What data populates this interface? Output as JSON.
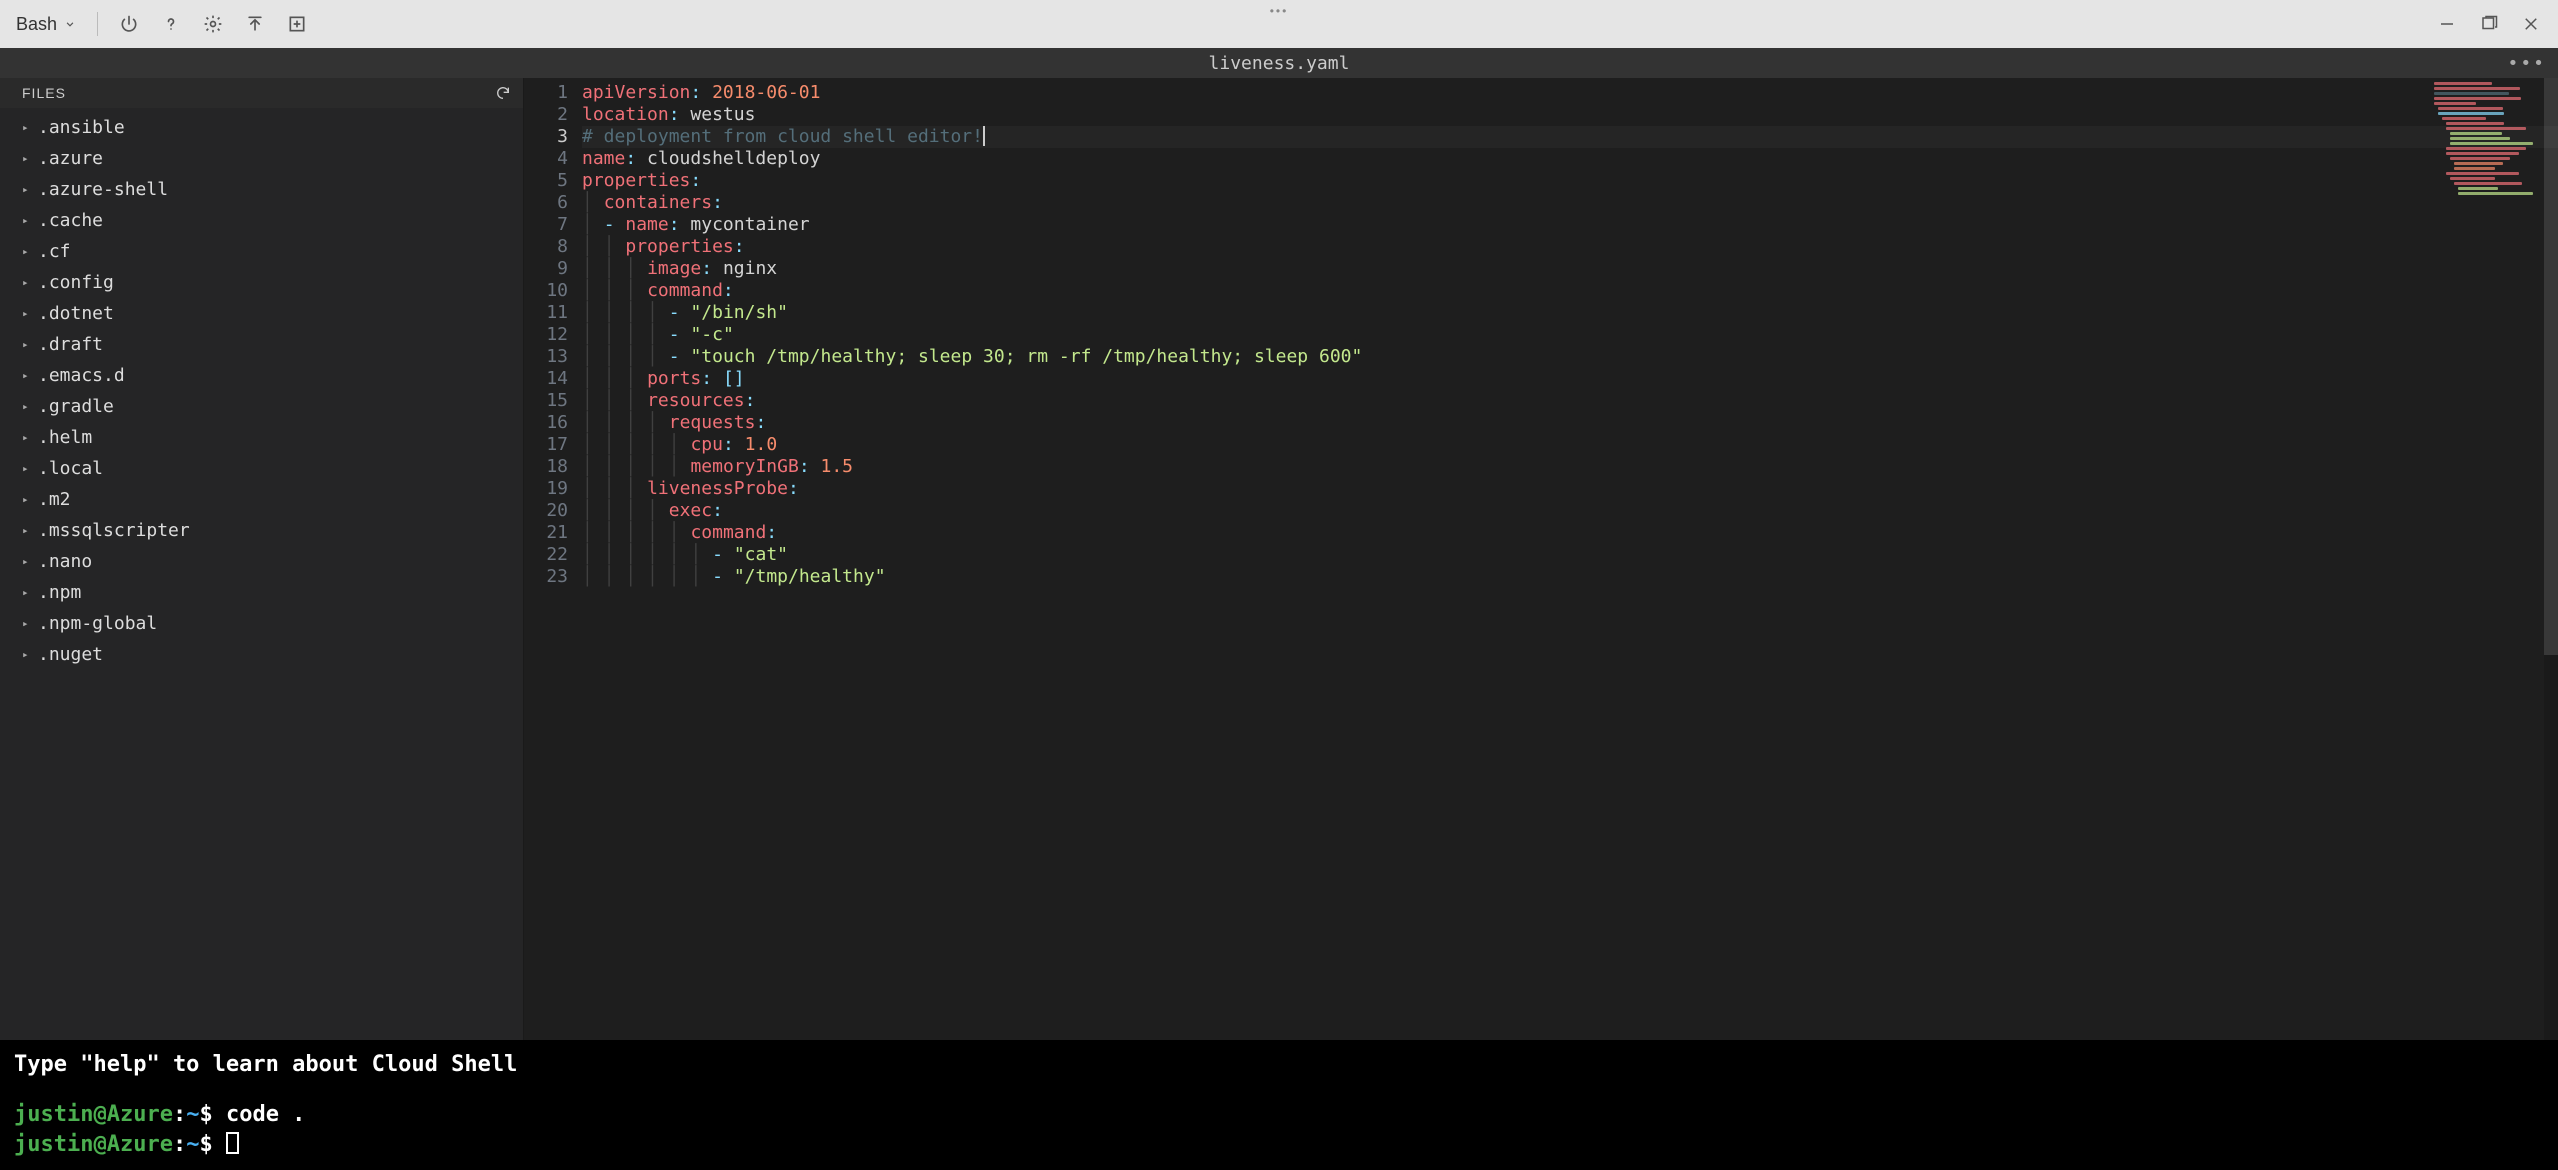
{
  "toolbar": {
    "shell_label": "Bash"
  },
  "editor": {
    "filename": "liveness.yaml",
    "sidebar_header": "FILES",
    "current_line": 3,
    "files": [
      ".ansible",
      ".azure",
      ".azure-shell",
      ".cache",
      ".cf",
      ".config",
      ".dotnet",
      ".draft",
      ".emacs.d",
      ".gradle",
      ".helm",
      ".local",
      ".m2",
      ".mssqlscripter",
      ".nano",
      ".npm",
      ".npm-global",
      ".nuget"
    ],
    "code": [
      {
        "n": 1,
        "t": [
          [
            "key",
            "apiVersion"
          ],
          [
            "punc",
            ": "
          ],
          [
            "num",
            "2018-06-01"
          ]
        ]
      },
      {
        "n": 2,
        "t": [
          [
            "key",
            "location"
          ],
          [
            "punc",
            ": "
          ],
          [
            "val",
            "westus"
          ]
        ]
      },
      {
        "n": 3,
        "t": [
          [
            "comment",
            "# deployment from cloud shell editor!"
          ]
        ],
        "cursor": true
      },
      {
        "n": 4,
        "t": [
          [
            "key",
            "name"
          ],
          [
            "punc",
            ": "
          ],
          [
            "val",
            "cloudshelldeploy"
          ]
        ]
      },
      {
        "n": 5,
        "t": [
          [
            "key",
            "properties"
          ],
          [
            "punc",
            ":"
          ]
        ]
      },
      {
        "n": 6,
        "indent": 1,
        "t": [
          [
            "key",
            "containers"
          ],
          [
            "punc",
            ":"
          ]
        ]
      },
      {
        "n": 7,
        "indent": 1,
        "t": [
          [
            "dash",
            "- "
          ],
          [
            "key",
            "name"
          ],
          [
            "punc",
            ": "
          ],
          [
            "val",
            "mycontainer"
          ]
        ]
      },
      {
        "n": 8,
        "indent": 2,
        "t": [
          [
            "key",
            "properties"
          ],
          [
            "punc",
            ":"
          ]
        ]
      },
      {
        "n": 9,
        "indent": 3,
        "t": [
          [
            "key",
            "image"
          ],
          [
            "punc",
            ": "
          ],
          [
            "val",
            "nginx"
          ]
        ]
      },
      {
        "n": 10,
        "indent": 3,
        "t": [
          [
            "key",
            "command"
          ],
          [
            "punc",
            ":"
          ]
        ]
      },
      {
        "n": 11,
        "indent": 4,
        "t": [
          [
            "dash",
            "- "
          ],
          [
            "str",
            "\"/bin/sh\""
          ]
        ]
      },
      {
        "n": 12,
        "indent": 4,
        "t": [
          [
            "dash",
            "- "
          ],
          [
            "str",
            "\"-c\""
          ]
        ]
      },
      {
        "n": 13,
        "indent": 4,
        "t": [
          [
            "dash",
            "- "
          ],
          [
            "str",
            "\"touch /tmp/healthy; sleep 30; rm -rf /tmp/healthy; sleep 600\""
          ]
        ]
      },
      {
        "n": 14,
        "indent": 3,
        "t": [
          [
            "key",
            "ports"
          ],
          [
            "punc",
            ": "
          ],
          [
            "punc",
            "[]"
          ]
        ]
      },
      {
        "n": 15,
        "indent": 3,
        "t": [
          [
            "key",
            "resources"
          ],
          [
            "punc",
            ":"
          ]
        ]
      },
      {
        "n": 16,
        "indent": 4,
        "t": [
          [
            "key",
            "requests"
          ],
          [
            "punc",
            ":"
          ]
        ]
      },
      {
        "n": 17,
        "indent": 5,
        "t": [
          [
            "key",
            "cpu"
          ],
          [
            "punc",
            ": "
          ],
          [
            "num",
            "1.0"
          ]
        ]
      },
      {
        "n": 18,
        "indent": 5,
        "t": [
          [
            "key",
            "memoryInGB"
          ],
          [
            "punc",
            ": "
          ],
          [
            "num",
            "1.5"
          ]
        ]
      },
      {
        "n": 19,
        "indent": 3,
        "t": [
          [
            "key",
            "livenessProbe"
          ],
          [
            "punc",
            ":"
          ]
        ]
      },
      {
        "n": 20,
        "indent": 4,
        "t": [
          [
            "key",
            "exec"
          ],
          [
            "punc",
            ":"
          ]
        ]
      },
      {
        "n": 21,
        "indent": 5,
        "t": [
          [
            "key",
            "command"
          ],
          [
            "punc",
            ":"
          ]
        ]
      },
      {
        "n": 22,
        "indent": 6,
        "t": [
          [
            "dash",
            "- "
          ],
          [
            "str",
            "\"cat\""
          ]
        ]
      },
      {
        "n": 23,
        "indent": 6,
        "t": [
          [
            "dash",
            "- "
          ],
          [
            "str",
            "\"/tmp/healthy\""
          ]
        ]
      }
    ]
  },
  "terminal": {
    "help_line": "Type \"help\" to learn about Cloud Shell",
    "user": "justin",
    "host": "Azure",
    "path": "~",
    "prompt_symbol": "$",
    "history": [
      "code ."
    ]
  },
  "minimap_colors": [
    "#f07178",
    "#f07178",
    "#546e7a",
    "#f07178",
    "#f07178",
    "#f07178",
    "#89ddff",
    "#f07178",
    "#f07178",
    "#f07178",
    "#c3e88d",
    "#c3e88d",
    "#c3e88d",
    "#f07178",
    "#f07178",
    "#f07178",
    "#f78c6c",
    "#f78c6c",
    "#f07178",
    "#f07178",
    "#f07178",
    "#c3e88d",
    "#c3e88d"
  ]
}
